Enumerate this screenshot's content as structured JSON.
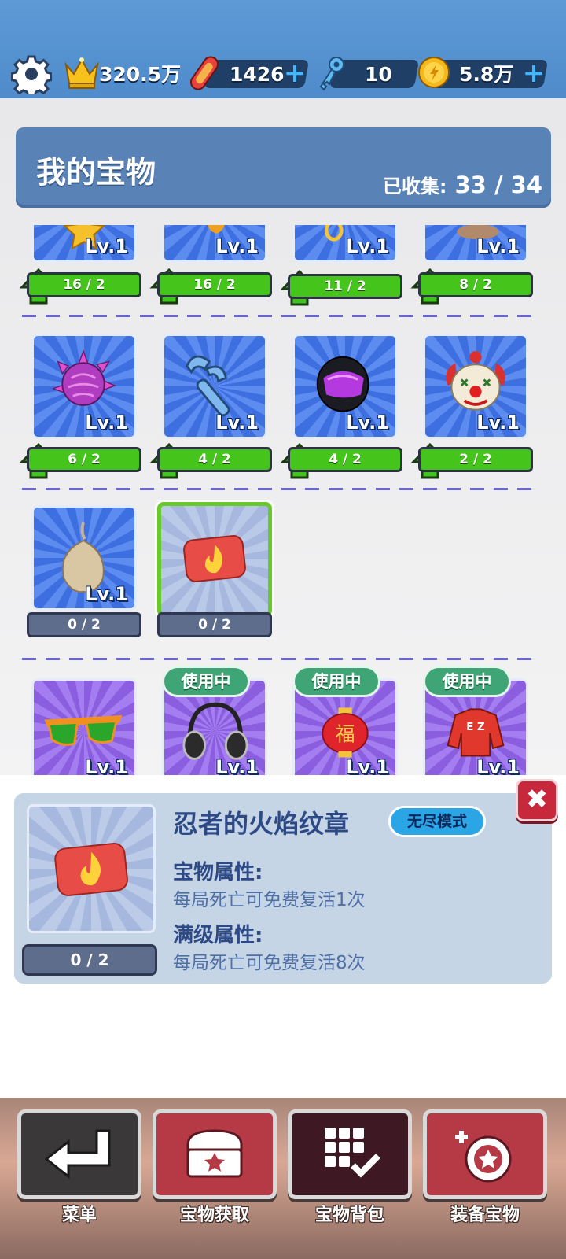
{
  "currency": {
    "crown": {
      "value": "320.5万"
    },
    "board": {
      "value": "1426"
    },
    "key": {
      "value": "10"
    },
    "coin": {
      "value": "5.8万"
    }
  },
  "panel": {
    "title": "我的宝物",
    "collected_label": "已收集:",
    "collected_value": "33 / 34"
  },
  "rows": [
    {
      "items": [
        {
          "level": "Lv.1",
          "progress": "16 / 2",
          "upgradable": true
        },
        {
          "level": "Lv.1",
          "progress": "16 / 2",
          "upgradable": true
        },
        {
          "level": "Lv.1",
          "progress": "11 / 2",
          "upgradable": true
        },
        {
          "level": "Lv.1",
          "progress": "8 / 2",
          "upgradable": true
        }
      ]
    },
    {
      "items": [
        {
          "level": "Lv.1",
          "progress": "6 / 2",
          "upgradable": true,
          "icon": "purple-flower-icon"
        },
        {
          "level": "Lv.1",
          "progress": "4 / 2",
          "upgradable": true,
          "icon": "wind-up-key-icon"
        },
        {
          "level": "Lv.1",
          "progress": "4 / 2",
          "upgradable": true,
          "icon": "helmet-icon"
        },
        {
          "level": "Lv.1",
          "progress": "2 / 2",
          "upgradable": true,
          "icon": "clown-mask-icon"
        }
      ]
    },
    {
      "items": [
        {
          "level": "Lv.1",
          "progress": "0 / 2",
          "upgradable": false,
          "icon": "pouch-icon"
        },
        {
          "level": "",
          "progress": "0 / 2",
          "upgradable": false,
          "icon": "fire-badge-icon",
          "selected": true
        }
      ]
    },
    {
      "items": [
        {
          "level": "Lv.1",
          "icon": "sunglasses-icon"
        },
        {
          "level": "Lv.1",
          "icon": "headphones-icon",
          "status": "使用中"
        },
        {
          "level": "Lv.1",
          "icon": "lantern-icon",
          "status": "使用中"
        },
        {
          "level": "Lv.1",
          "icon": "jacket-icon",
          "status": "使用中"
        }
      ]
    }
  ],
  "detail": {
    "name": "忍者的火焰纹章",
    "mode": "无尽模式",
    "progress": "0 / 2",
    "attr_title": "宝物属性:",
    "attr_value": "每局死亡可免费复活1次",
    "max_title": "满级属性:",
    "max_value": "每局死亡可免费复活8次",
    "close": "✖"
  },
  "nav": [
    {
      "label": "菜单",
      "icon": "return-arrow-icon"
    },
    {
      "label": "宝物获取",
      "icon": "treasure-chest-icon"
    },
    {
      "label": "宝物背包",
      "icon": "grid-check-icon"
    },
    {
      "label": "装备宝物",
      "icon": "equip-badge-icon"
    }
  ],
  "colors": {
    "topbar": "#5d9ad6",
    "progress_green": "#45c41c",
    "progress_gray": "#5e6d8c",
    "in_use_green": "#3fa577",
    "close_red": "#c8283b"
  }
}
